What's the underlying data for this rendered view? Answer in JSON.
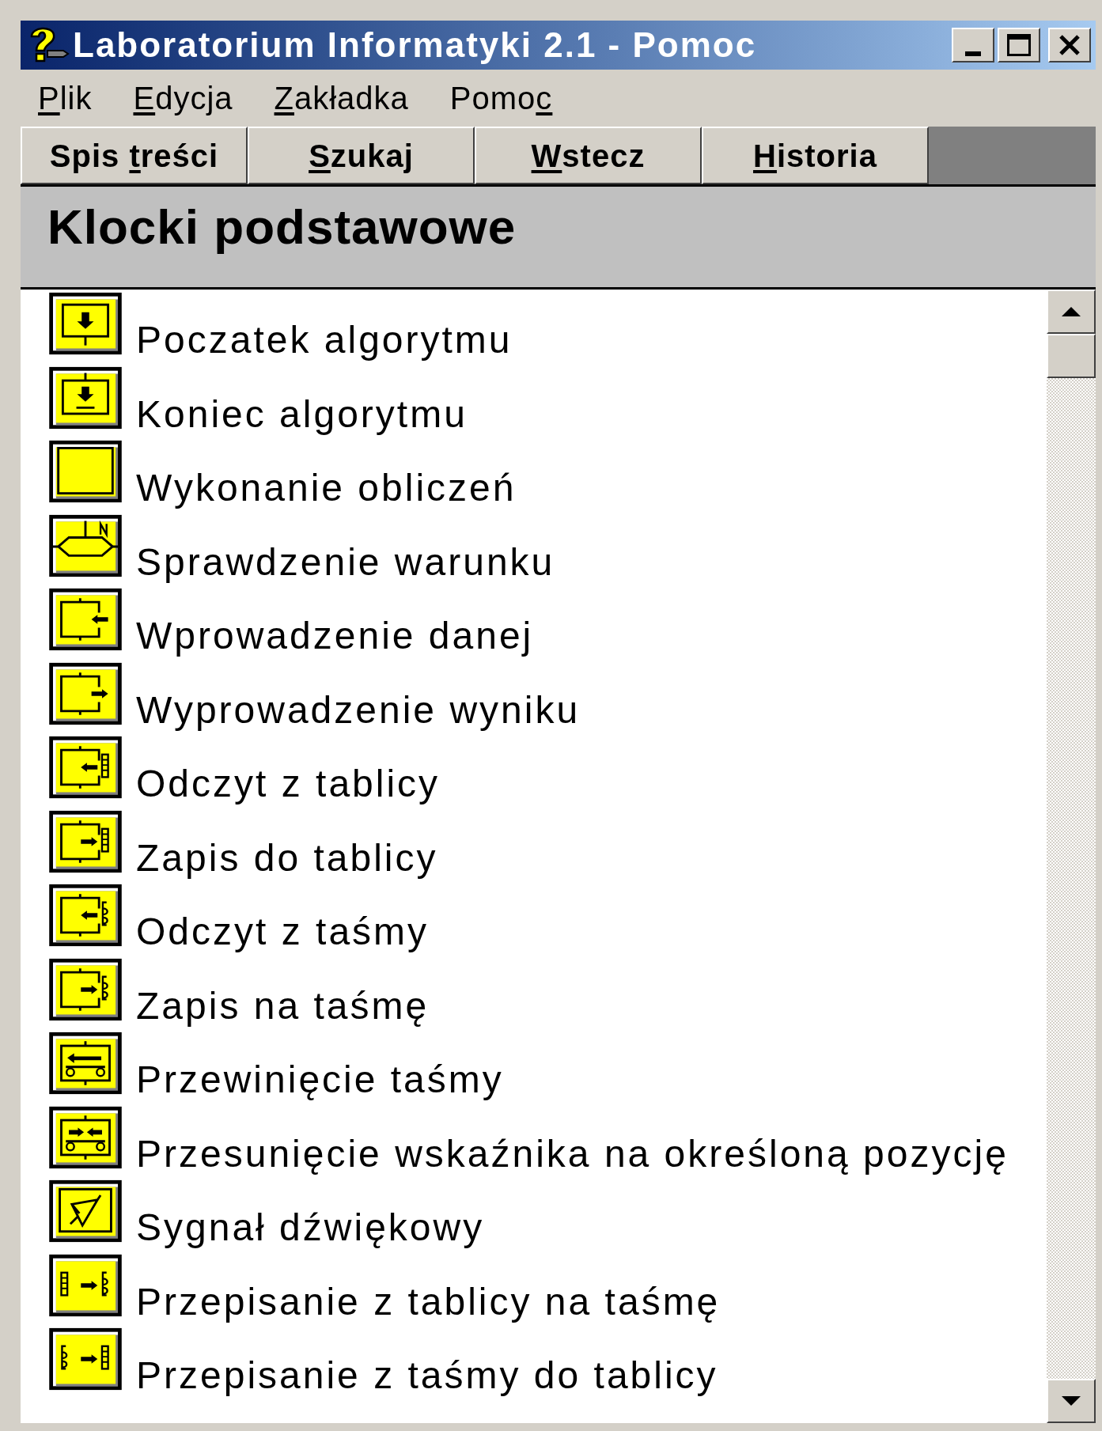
{
  "window": {
    "title": "Laboratorium Informatyki 2.1 - Pomoc"
  },
  "menu": [
    {
      "key": "P",
      "after": "lik"
    },
    {
      "key": "E",
      "after": "dycja"
    },
    {
      "key": "Z",
      "after": "akładka"
    },
    {
      "before": "Pomo",
      "key": "c"
    }
  ],
  "toolbar": [
    {
      "before": "Spis ",
      "key": "t",
      "after": "reści"
    },
    {
      "key": "S",
      "after": "zukaj"
    },
    {
      "key": "W",
      "after": "stecz"
    },
    {
      "key": "H",
      "after": "istoria"
    }
  ],
  "heading": "Klocki podstawowe",
  "items": [
    {
      "label": "Poczatek algorytmu"
    },
    {
      "label": "Koniec algorytmu"
    },
    {
      "label": "Wykonanie obliczeń"
    },
    {
      "label": "Sprawdzenie warunku"
    },
    {
      "label": "Wprowadzenie danej"
    },
    {
      "label": "Wyprowadzenie wyniku"
    },
    {
      "label": "Odczyt z tablicy"
    },
    {
      "label": "Zapis do tablicy"
    },
    {
      "label": "Odczyt z taśmy"
    },
    {
      "label": "Zapis na taśmę"
    },
    {
      "label": "Przewinięcie taśmy"
    },
    {
      "label": "Przesunięcie wskaźnika na określoną pozycję"
    },
    {
      "label": "Sygnał dźwiękowy"
    },
    {
      "label": "Przepisanie z tablicy na taśmę"
    },
    {
      "label": "Przepisanie z taśmy do tablicy"
    }
  ]
}
